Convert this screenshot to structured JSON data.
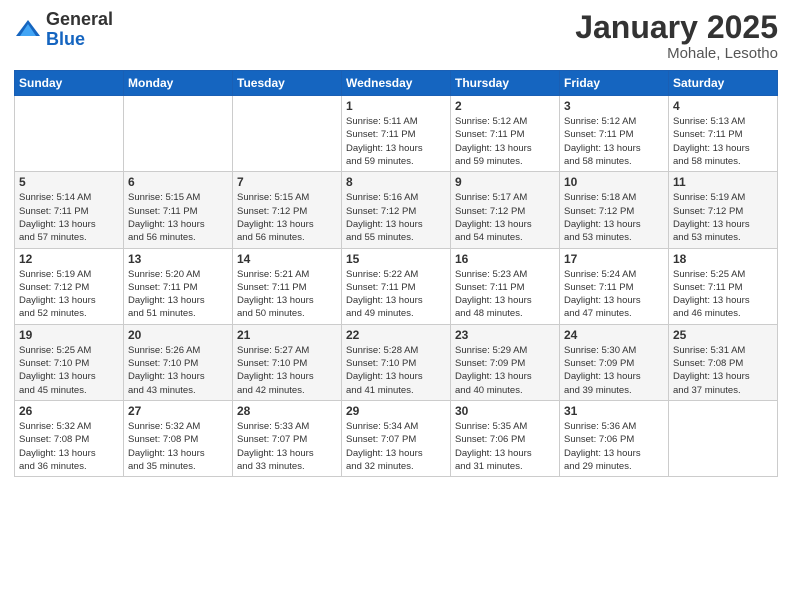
{
  "logo": {
    "general": "General",
    "blue": "Blue"
  },
  "header": {
    "month": "January 2025",
    "location": "Mohale, Lesotho"
  },
  "weekdays": [
    "Sunday",
    "Monday",
    "Tuesday",
    "Wednesday",
    "Thursday",
    "Friday",
    "Saturday"
  ],
  "weeks": [
    [
      {
        "day": "",
        "info": ""
      },
      {
        "day": "",
        "info": ""
      },
      {
        "day": "",
        "info": ""
      },
      {
        "day": "1",
        "info": "Sunrise: 5:11 AM\nSunset: 7:11 PM\nDaylight: 13 hours\nand 59 minutes."
      },
      {
        "day": "2",
        "info": "Sunrise: 5:12 AM\nSunset: 7:11 PM\nDaylight: 13 hours\nand 59 minutes."
      },
      {
        "day": "3",
        "info": "Sunrise: 5:12 AM\nSunset: 7:11 PM\nDaylight: 13 hours\nand 58 minutes."
      },
      {
        "day": "4",
        "info": "Sunrise: 5:13 AM\nSunset: 7:11 PM\nDaylight: 13 hours\nand 58 minutes."
      }
    ],
    [
      {
        "day": "5",
        "info": "Sunrise: 5:14 AM\nSunset: 7:11 PM\nDaylight: 13 hours\nand 57 minutes."
      },
      {
        "day": "6",
        "info": "Sunrise: 5:15 AM\nSunset: 7:11 PM\nDaylight: 13 hours\nand 56 minutes."
      },
      {
        "day": "7",
        "info": "Sunrise: 5:15 AM\nSunset: 7:12 PM\nDaylight: 13 hours\nand 56 minutes."
      },
      {
        "day": "8",
        "info": "Sunrise: 5:16 AM\nSunset: 7:12 PM\nDaylight: 13 hours\nand 55 minutes."
      },
      {
        "day": "9",
        "info": "Sunrise: 5:17 AM\nSunset: 7:12 PM\nDaylight: 13 hours\nand 54 minutes."
      },
      {
        "day": "10",
        "info": "Sunrise: 5:18 AM\nSunset: 7:12 PM\nDaylight: 13 hours\nand 53 minutes."
      },
      {
        "day": "11",
        "info": "Sunrise: 5:19 AM\nSunset: 7:12 PM\nDaylight: 13 hours\nand 53 minutes."
      }
    ],
    [
      {
        "day": "12",
        "info": "Sunrise: 5:19 AM\nSunset: 7:12 PM\nDaylight: 13 hours\nand 52 minutes."
      },
      {
        "day": "13",
        "info": "Sunrise: 5:20 AM\nSunset: 7:11 PM\nDaylight: 13 hours\nand 51 minutes."
      },
      {
        "day": "14",
        "info": "Sunrise: 5:21 AM\nSunset: 7:11 PM\nDaylight: 13 hours\nand 50 minutes."
      },
      {
        "day": "15",
        "info": "Sunrise: 5:22 AM\nSunset: 7:11 PM\nDaylight: 13 hours\nand 49 minutes."
      },
      {
        "day": "16",
        "info": "Sunrise: 5:23 AM\nSunset: 7:11 PM\nDaylight: 13 hours\nand 48 minutes."
      },
      {
        "day": "17",
        "info": "Sunrise: 5:24 AM\nSunset: 7:11 PM\nDaylight: 13 hours\nand 47 minutes."
      },
      {
        "day": "18",
        "info": "Sunrise: 5:25 AM\nSunset: 7:11 PM\nDaylight: 13 hours\nand 46 minutes."
      }
    ],
    [
      {
        "day": "19",
        "info": "Sunrise: 5:25 AM\nSunset: 7:10 PM\nDaylight: 13 hours\nand 45 minutes."
      },
      {
        "day": "20",
        "info": "Sunrise: 5:26 AM\nSunset: 7:10 PM\nDaylight: 13 hours\nand 43 minutes."
      },
      {
        "day": "21",
        "info": "Sunrise: 5:27 AM\nSunset: 7:10 PM\nDaylight: 13 hours\nand 42 minutes."
      },
      {
        "day": "22",
        "info": "Sunrise: 5:28 AM\nSunset: 7:10 PM\nDaylight: 13 hours\nand 41 minutes."
      },
      {
        "day": "23",
        "info": "Sunrise: 5:29 AM\nSunset: 7:09 PM\nDaylight: 13 hours\nand 40 minutes."
      },
      {
        "day": "24",
        "info": "Sunrise: 5:30 AM\nSunset: 7:09 PM\nDaylight: 13 hours\nand 39 minutes."
      },
      {
        "day": "25",
        "info": "Sunrise: 5:31 AM\nSunset: 7:08 PM\nDaylight: 13 hours\nand 37 minutes."
      }
    ],
    [
      {
        "day": "26",
        "info": "Sunrise: 5:32 AM\nSunset: 7:08 PM\nDaylight: 13 hours\nand 36 minutes."
      },
      {
        "day": "27",
        "info": "Sunrise: 5:32 AM\nSunset: 7:08 PM\nDaylight: 13 hours\nand 35 minutes."
      },
      {
        "day": "28",
        "info": "Sunrise: 5:33 AM\nSunset: 7:07 PM\nDaylight: 13 hours\nand 33 minutes."
      },
      {
        "day": "29",
        "info": "Sunrise: 5:34 AM\nSunset: 7:07 PM\nDaylight: 13 hours\nand 32 minutes."
      },
      {
        "day": "30",
        "info": "Sunrise: 5:35 AM\nSunset: 7:06 PM\nDaylight: 13 hours\nand 31 minutes."
      },
      {
        "day": "31",
        "info": "Sunrise: 5:36 AM\nSunset: 7:06 PM\nDaylight: 13 hours\nand 29 minutes."
      },
      {
        "day": "",
        "info": ""
      }
    ]
  ]
}
